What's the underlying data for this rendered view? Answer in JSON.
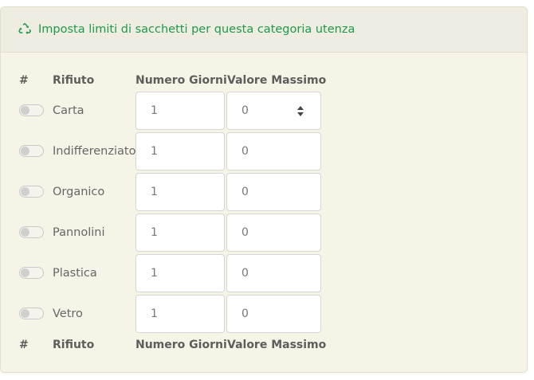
{
  "panel": {
    "title": "Imposta limiti di sacchetti per questa categoria utenza",
    "icon": "recycle-icon",
    "accent_color": "#1b9a4d"
  },
  "table": {
    "headers": [
      "#",
      "Rifiuto",
      "Numero Giorni",
      "Valore Massimo"
    ],
    "footer": [
      "#",
      "Rifiuto",
      "Numero Giorni",
      "Valore Massimo"
    ],
    "rows": [
      {
        "enabled": false,
        "rifiuto": "Carta",
        "numero_giorni": "1",
        "valore_massimo": "0"
      },
      {
        "enabled": false,
        "rifiuto": "Indifferenziato",
        "numero_giorni": "1",
        "valore_massimo": "0"
      },
      {
        "enabled": false,
        "rifiuto": "Organico",
        "numero_giorni": "1",
        "valore_massimo": "0"
      },
      {
        "enabled": false,
        "rifiuto": "Pannolini",
        "numero_giorni": "1",
        "valore_massimo": "0"
      },
      {
        "enabled": false,
        "rifiuto": "Plastica",
        "numero_giorni": "1",
        "valore_massimo": "0"
      },
      {
        "enabled": false,
        "rifiuto": "Vetro",
        "numero_giorni": "1",
        "valore_massimo": "0"
      }
    ]
  }
}
